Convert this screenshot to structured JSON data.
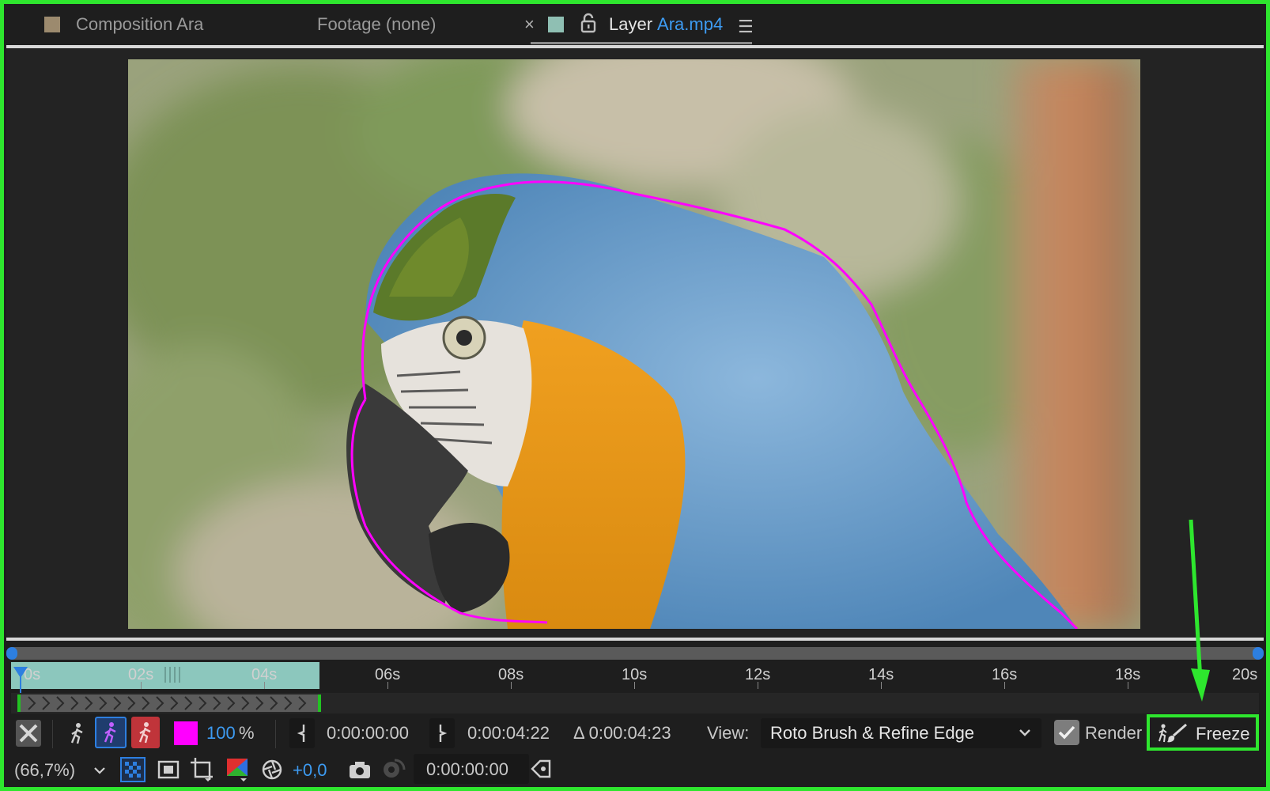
{
  "tabs": {
    "composition": {
      "label": "Composition Ara"
    },
    "footage": {
      "label": "Footage (none)"
    },
    "layer": {
      "prefix": "Layer",
      "name": "Ara.mp4"
    }
  },
  "timeline": {
    "ticks": [
      "0s",
      "02s",
      "04s",
      "06s",
      "08s",
      "10s",
      "12s",
      "14s",
      "16s",
      "18s",
      "20s"
    ]
  },
  "controls": {
    "opacity_value": "100",
    "opacity_unit": "%",
    "in_time": "0:00:00:00",
    "out_time": "0:00:04:22",
    "duration": "Δ 0:00:04:23",
    "view_label": "View:",
    "view_mode": "Roto Brush & Refine Edge",
    "render_label": "Render",
    "freeze_label": "Freeze",
    "overlay_color": "#ff00ff"
  },
  "footer": {
    "zoom": "(66,7%)",
    "exposure": "+0,0",
    "current_time": "0:00:00:00"
  },
  "colors": {
    "accent_blue": "#3d9bf2",
    "annotation_green": "#2ee62e",
    "range_teal": "#8cc7bd"
  }
}
